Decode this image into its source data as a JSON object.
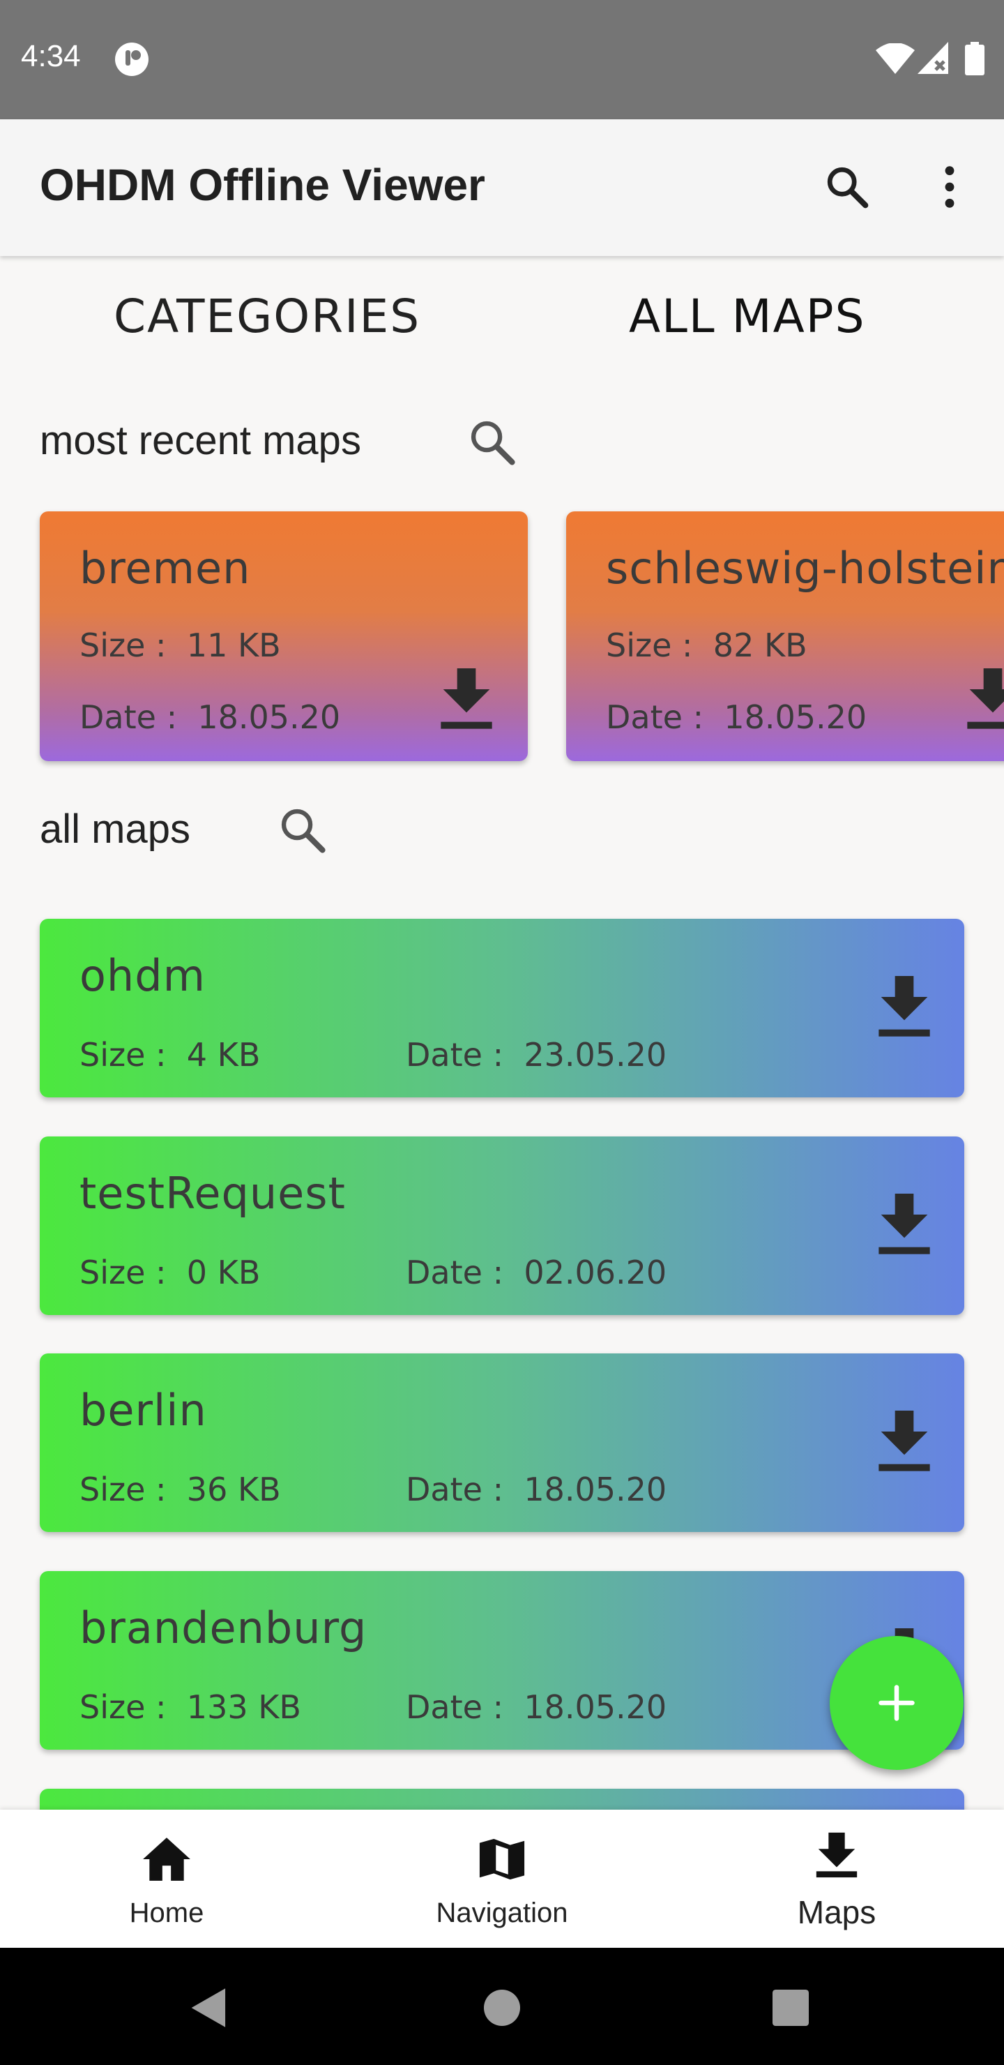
{
  "status_bar": {
    "time": "4:34"
  },
  "app_bar": {
    "title": "OHDM Offline Viewer",
    "search_icon": "search-icon",
    "menu_icon": "more-vert-icon"
  },
  "tabs": [
    {
      "label": "CATEGORIES"
    },
    {
      "label": "ALL MAPS"
    }
  ],
  "recent_section": {
    "title": "most recent maps"
  },
  "recent_maps": [
    {
      "name": "bremen",
      "size_label": "Size :",
      "size": "11 KB",
      "date_label": "Date :",
      "date": "18.05.20"
    },
    {
      "name": "schleswig-holstein",
      "size_label": "Size :",
      "size": "82 KB",
      "date_label": "Date :",
      "date": "18.05.20"
    }
  ],
  "all_section": {
    "title": "all maps"
  },
  "all_maps": [
    {
      "name": "ohdm",
      "size_label": "Size :",
      "size": "4 KB",
      "date_label": "Date :",
      "date": "23.05.20"
    },
    {
      "name": "testRequest",
      "size_label": "Size :",
      "size": "0 KB",
      "date_label": "Date :",
      "date": "02.06.20"
    },
    {
      "name": "berlin",
      "size_label": "Size :",
      "size": "36 KB",
      "date_label": "Date :",
      "date": "18.05.20"
    },
    {
      "name": "brandenburg",
      "size_label": "Size :",
      "size": "133 KB",
      "date_label": "Date :",
      "date": "18.05.20"
    }
  ],
  "fab": {
    "icon": "plus-icon"
  },
  "bottom_nav": [
    {
      "label": "Home",
      "icon": "home-icon"
    },
    {
      "label": "Navigation",
      "icon": "map-icon"
    },
    {
      "label": "Maps",
      "icon": "download-icon",
      "active": true
    }
  ],
  "colors": {
    "recent_gradient_top": "#ef7a33",
    "recent_gradient_bottom": "#9c69dd",
    "list_gradient_left": "#4ce83e",
    "list_gradient_right": "#6683e3",
    "fab": "#45e23c"
  }
}
